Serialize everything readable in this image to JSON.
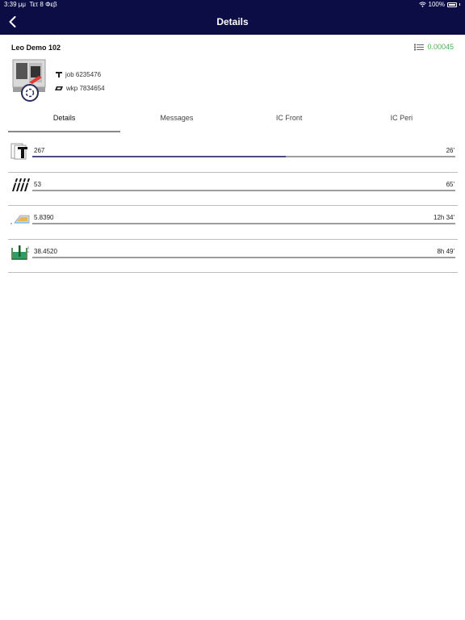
{
  "status_bar": {
    "time": "3:39 μμ",
    "date": "Τετ 8 Φεβ",
    "battery": "100%"
  },
  "nav": {
    "title": "Details",
    "back_icon": "chevron-left-icon"
  },
  "header": {
    "machine_name": "Leo Demo 102",
    "counter_value": "0.00045",
    "job": "job 6235476",
    "wkp": "wkp 7834654",
    "accent_color": "#4caf50"
  },
  "tabs": [
    {
      "label": "Details",
      "active": true
    },
    {
      "label": "Messages",
      "active": false
    },
    {
      "label": "IC Front",
      "active": false
    },
    {
      "label": "IC Peri",
      "active": false
    }
  ],
  "rows": [
    {
      "icon": "panel-stack-icon",
      "value": "267",
      "time": "26'",
      "progress": 0.6
    },
    {
      "icon": "blades-icon",
      "value": "53",
      "time": "65'",
      "progress": 0
    },
    {
      "icon": "wedge-icon",
      "value": "5.8390",
      "time": "12h 34'",
      "progress": 0
    },
    {
      "icon": "coolant-tank-icon",
      "value": "38.4520",
      "time": "8h 49'",
      "progress": 0
    }
  ]
}
